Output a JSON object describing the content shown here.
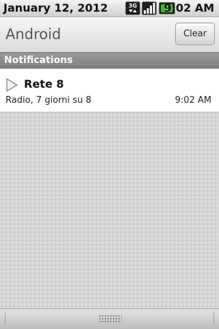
{
  "status_bar": {
    "date": "January 12, 2012",
    "time": "9:02 AM",
    "network_icon": "3g-icon",
    "signal_icon": "signal-icon",
    "battery_icon": "charging-battery-icon",
    "battery_color": "#3db52d"
  },
  "title_bar": {
    "title": "Android",
    "clear_label": "Clear"
  },
  "section": {
    "label": "Notifications"
  },
  "notification": {
    "icon": "play-icon",
    "title": "Rete 8",
    "text": "Radio, 7 giorni su 8",
    "time": "9:02 AM"
  },
  "bottom_bar": {
    "handle_icon": "grip-handle-icon"
  }
}
